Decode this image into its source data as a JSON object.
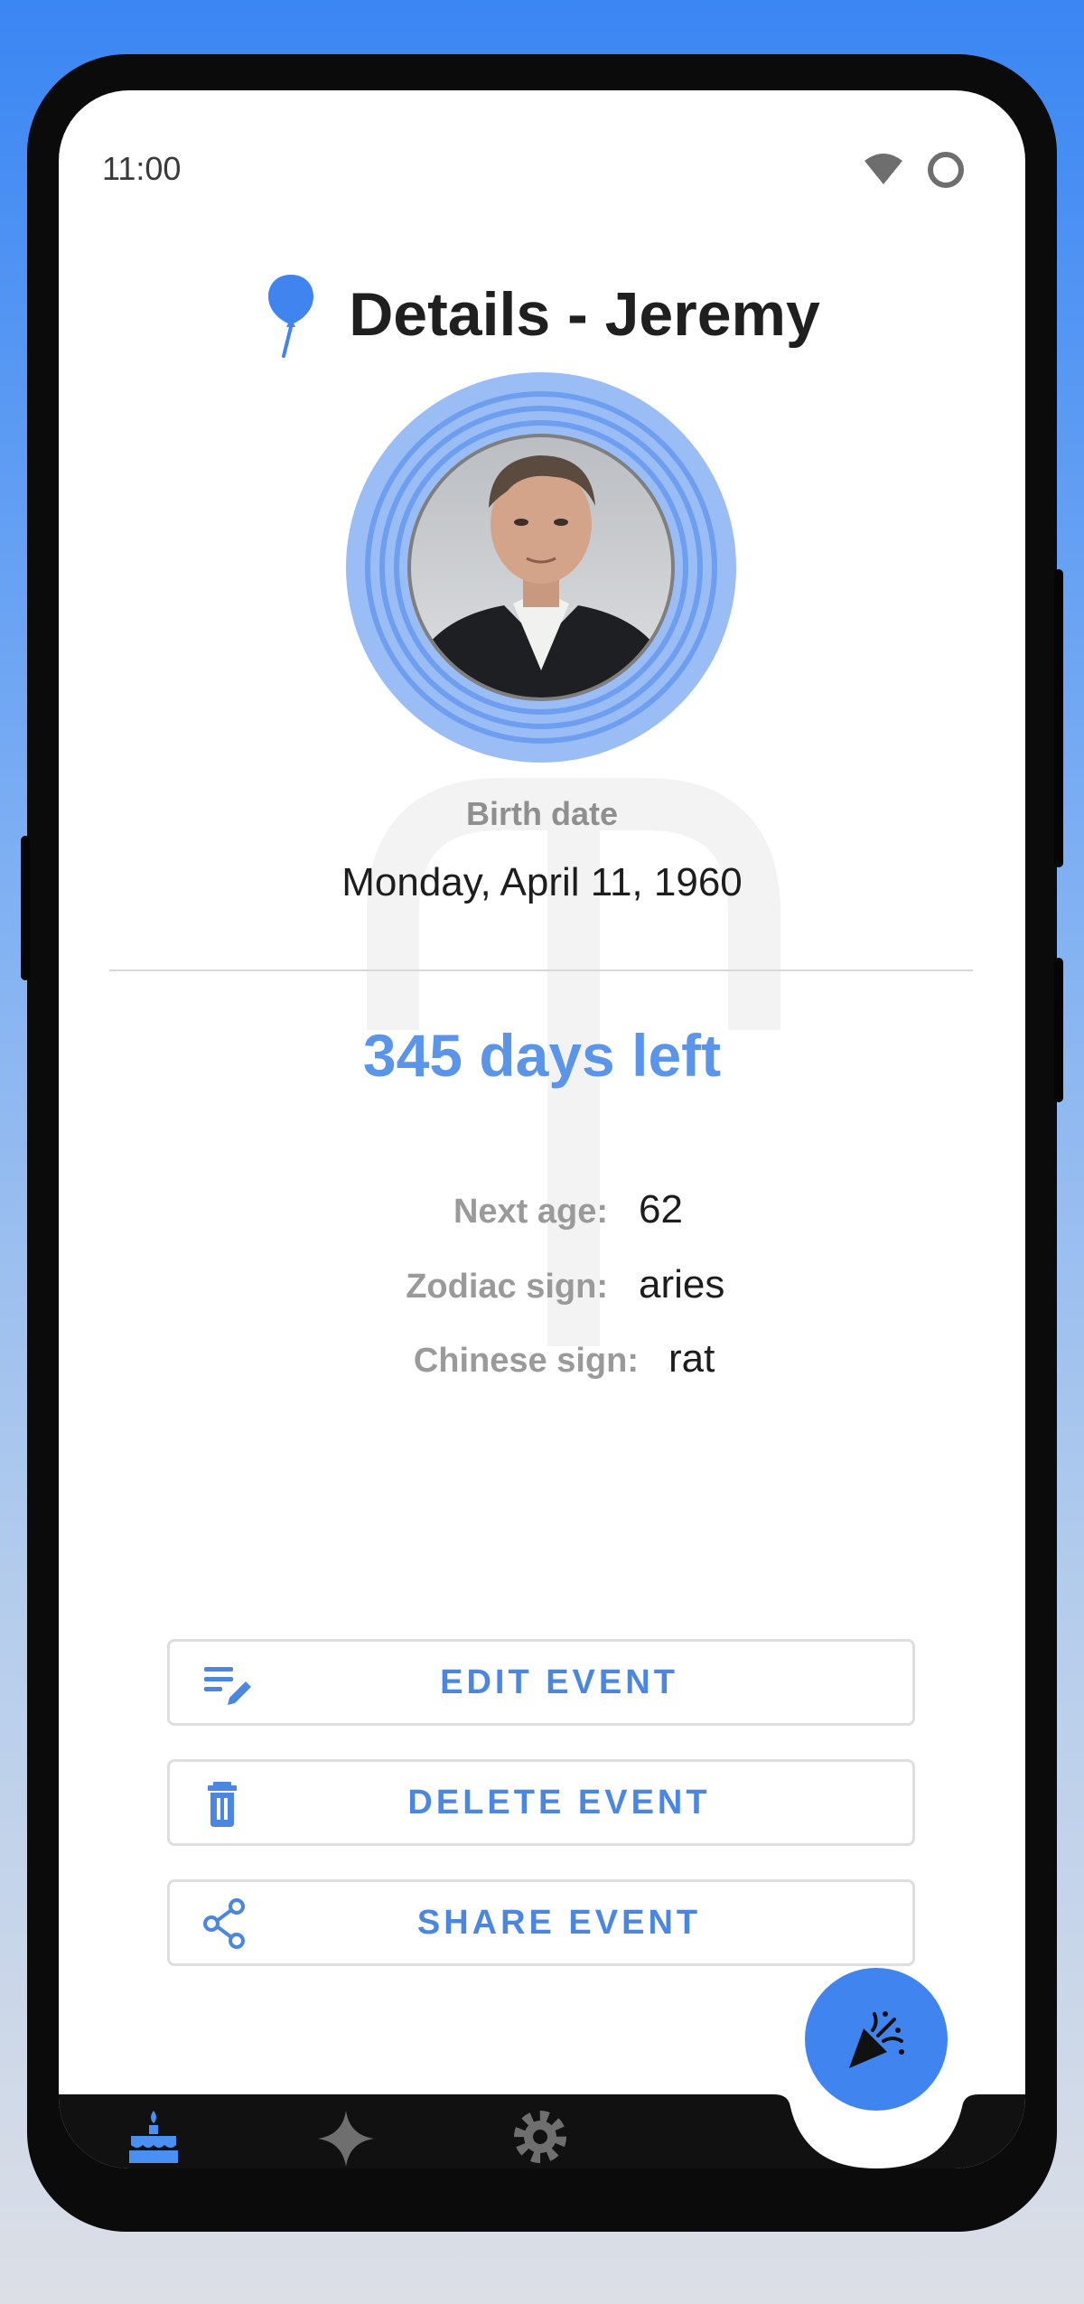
{
  "status_bar": {
    "time": "11:00"
  },
  "header": {
    "title": "Details - Jeremy"
  },
  "profile": {
    "avatar_alt": "Jeremy",
    "birth_label": "Birth date",
    "birth_value": "Monday, April 11, 1960"
  },
  "countdown": {
    "text": "345 days left"
  },
  "details": [
    {
      "label": "Next age:",
      "value": "62"
    },
    {
      "label": "Zodiac sign:",
      "value": "aries"
    },
    {
      "label": "Chinese sign:",
      "value": "rat"
    }
  ],
  "actions": {
    "edit_label": "EDIT EVENT",
    "delete_label": "DELETE EVENT",
    "share_label": "SHARE EVENT"
  },
  "bottom_nav": {
    "items": [
      {
        "icon": "cake-icon",
        "active": true
      },
      {
        "icon": "sparkle-icon",
        "active": false
      },
      {
        "icon": "gear-icon",
        "active": false
      }
    ],
    "fab_icon": "party-popper-icon"
  },
  "colors": {
    "accent": "#3f84ef",
    "accent_text": "#5b95ea",
    "label_gray": "#9a9a9a",
    "nav_bar": "#111111"
  }
}
